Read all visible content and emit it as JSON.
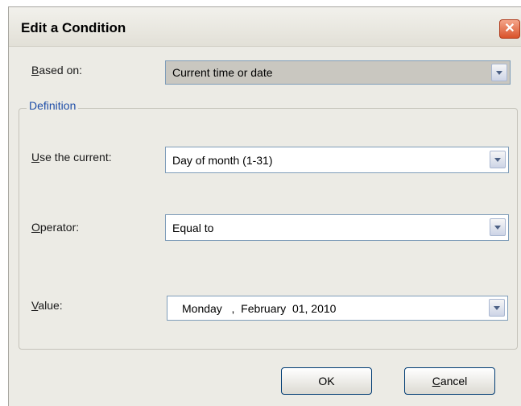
{
  "dialog": {
    "title": "Edit a Condition",
    "close_symbol": "✕"
  },
  "based_on": {
    "label_mnemonic": "B",
    "label_rest": "ased on:",
    "value": "Current time or date"
  },
  "definition": {
    "title": "Definition",
    "use_current": {
      "label_mnemonic": "U",
      "label_rest": "se the current:",
      "value": "Day of month (1-31)"
    },
    "operator": {
      "label_mnemonic": "O",
      "label_rest": "perator:",
      "value": "Equal to"
    },
    "value": {
      "label_mnemonic": "V",
      "label_rest": "alue:",
      "date_text": "Monday   ,  February  01, 2010"
    }
  },
  "buttons": {
    "ok": "OK",
    "cancel_mnemonic": "C",
    "cancel_rest": "ancel"
  },
  "colors": {
    "group_title": "#1f4ea8",
    "close_button": "#d9522a",
    "dialog_bg": "#ecebe5"
  }
}
